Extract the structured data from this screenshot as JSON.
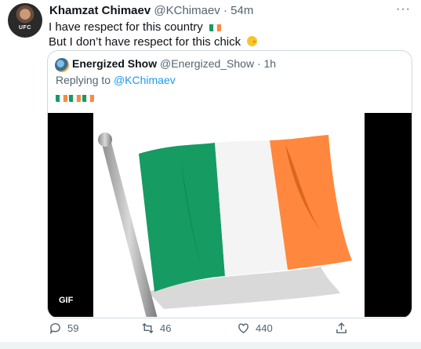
{
  "tweet": {
    "author_name": "Khamzat Chimaev",
    "author_handle": "@KChimaev",
    "time": "· 54m",
    "line1": "I have respect for this country",
    "line2": "But I don’t have respect for this chick",
    "more": "···",
    "avatar_badge": "UFC"
  },
  "quote": {
    "author_name": "Energized Show",
    "author_handle": "@Energized_Show",
    "time": "· 1h",
    "replying_prefix": "Replying to",
    "replying_to": "@KChimaev",
    "gif_badge": "GIF"
  },
  "actions": {
    "replies": "59",
    "retweets": "46",
    "likes": "440"
  },
  "colors": {
    "flag_green": "#169b62",
    "flag_white": "#ffffff",
    "flag_orange": "#ff883e",
    "link": "#1d9bf0"
  },
  "icons": [
    "avatar",
    "ireland-flag-emoji",
    "chick-emoji",
    "reply-icon",
    "retweet-icon",
    "like-icon",
    "share-icon",
    "more-icon"
  ]
}
